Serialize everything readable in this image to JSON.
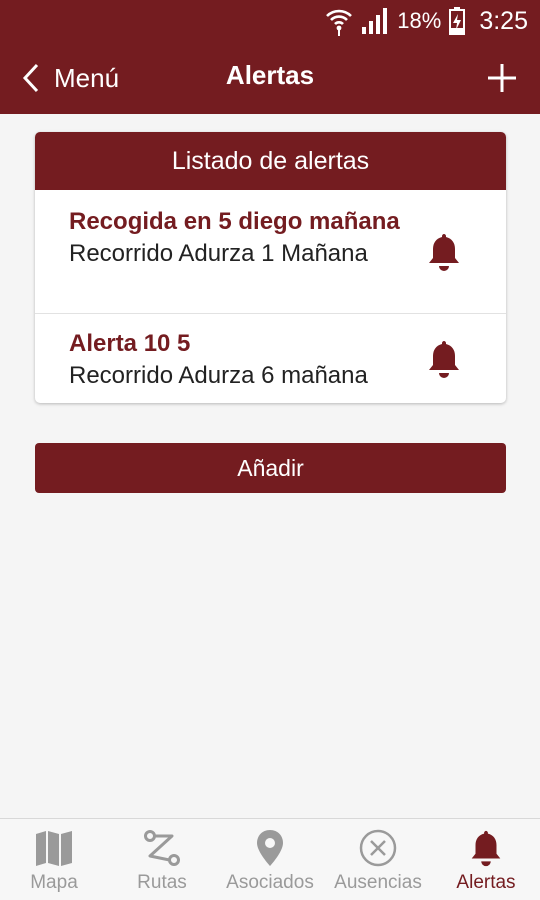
{
  "status_bar": {
    "battery": "18%",
    "time": "3:25"
  },
  "app_bar": {
    "back_label": "Menú",
    "title": "Alertas"
  },
  "alerts_card": {
    "header": "Listado de alertas",
    "items": [
      {
        "title": "Recogida en 5 diego mañana",
        "subtitle": "Recorrido Adurza 1 Mañana"
      },
      {
        "title": "Alerta 10 5",
        "subtitle": "Recorrido Adurza 6 mañana"
      }
    ]
  },
  "add_button_label": "Añadir",
  "bottom_nav": {
    "items": [
      {
        "label": "Mapa",
        "icon": "map-icon"
      },
      {
        "label": "Rutas",
        "icon": "route-icon"
      },
      {
        "label": "Asociados",
        "icon": "location-pin-icon"
      },
      {
        "label": "Ausencias",
        "icon": "circle-x-icon"
      },
      {
        "label": "Alertas",
        "icon": "bell-icon"
      }
    ],
    "active_index": 4
  },
  "colors": {
    "primary": "#741c20",
    "background": "#f5f5f5",
    "inactive": "#9a9a9a"
  }
}
